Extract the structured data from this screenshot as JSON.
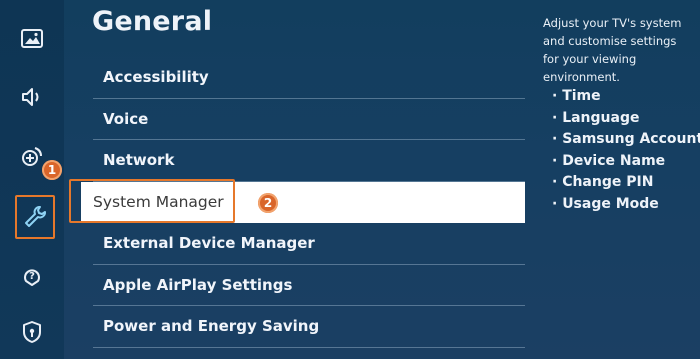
{
  "page": {
    "title": "General"
  },
  "sidebar": {
    "items": [
      {
        "icon": "picture-icon"
      },
      {
        "icon": "sound-icon"
      },
      {
        "icon": "broadcast-icon"
      },
      {
        "icon": "wrench-icon",
        "active": true
      },
      {
        "icon": "support-icon"
      },
      {
        "icon": "privacy-shield-icon"
      }
    ]
  },
  "menu": {
    "items": [
      {
        "label": "Accessibility"
      },
      {
        "label": "Voice"
      },
      {
        "label": "Network"
      },
      {
        "label": "System Manager",
        "selected": true
      },
      {
        "label": "External Device Manager"
      },
      {
        "label": "Apple AirPlay Settings"
      },
      {
        "label": "Power and Energy Saving"
      }
    ]
  },
  "annotations": {
    "step1": "1",
    "step2": "2"
  },
  "info": {
    "description": "Adjust your TV's system and customise settings for your viewing environment.",
    "bullets": [
      "· Time",
      "· Language",
      "· Samsung Account",
      "· Device Name",
      "· Change PIN",
      "· Usage Mode"
    ]
  },
  "colors": {
    "accent": "#e6782b",
    "badge": "#d9652a",
    "background": "#163f62"
  }
}
